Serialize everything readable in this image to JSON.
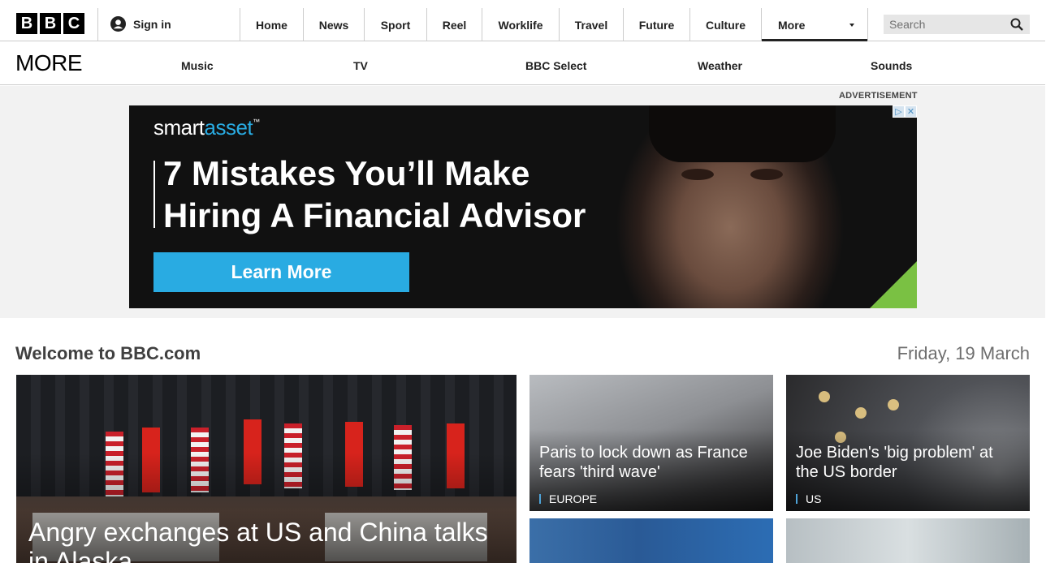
{
  "header": {
    "logo_letters": [
      "B",
      "B",
      "C"
    ],
    "sign_in": "Sign in",
    "nav": [
      {
        "label": "Home"
      },
      {
        "label": "News"
      },
      {
        "label": "Sport"
      },
      {
        "label": "Reel"
      },
      {
        "label": "Worklife"
      },
      {
        "label": "Travel"
      },
      {
        "label": "Future"
      },
      {
        "label": "Culture"
      },
      {
        "label": "More"
      }
    ],
    "search_placeholder": "Search"
  },
  "more_bar": {
    "title": "MORE",
    "links": [
      "Music",
      "TV",
      "BBC Select",
      "Weather",
      "Sounds"
    ]
  },
  "advert": {
    "label": "ADVERTISEMENT",
    "brand_a": "smart",
    "brand_b": "asset",
    "brand_tm": "™",
    "headline": "7 Mistakes You’ll Make Hiring A Financial Advisor",
    "cta": "Learn More",
    "choices_icons": [
      "adchoices-icon",
      "close-icon"
    ],
    "accent_color": "#29abe2"
  },
  "welcome": {
    "title": "Welcome to BBC.com",
    "date": "Friday, 19 March"
  },
  "stories": {
    "main": {
      "headline": "Angry exchanges at US and China talks in Alaska"
    },
    "paris": {
      "headline": "Paris to lock down as France fears 'third wave'",
      "tag": "EUROPE"
    },
    "biden": {
      "headline": "Joe Biden's 'big problem' at the US border",
      "tag": "US"
    }
  }
}
